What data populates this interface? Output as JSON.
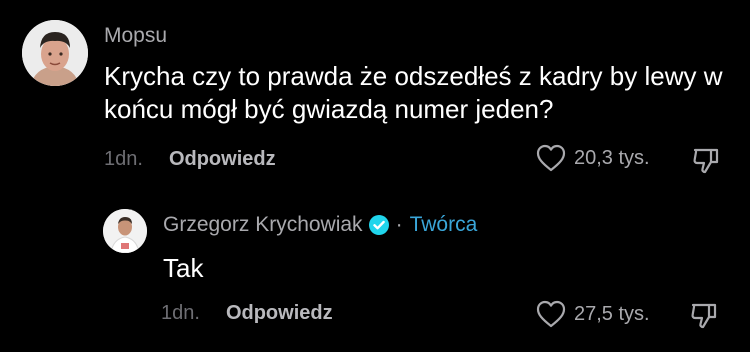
{
  "comments": [
    {
      "username": "Mopsu",
      "text": "Krycha czy to prawda że odszedłeś z kadry by lewy w końcu mógł być gwiazdą numer jeden?",
      "time": "1dn.",
      "reply_label": "Odpowiedz",
      "likes": "20,3 tys."
    },
    {
      "username": "Grzegorz Krychowiak",
      "badge_separator": "·",
      "badge_label": "Twórca",
      "text": "Tak",
      "time": "1dn.",
      "reply_label": "Odpowiedz",
      "likes": "27,5 tys."
    }
  ],
  "colors": {
    "background": "#000000",
    "secondary_text": "#a9a9ad",
    "creator_badge": "#3aa6d9",
    "verified": "#20d5ec"
  },
  "icons": [
    "heart-icon",
    "dislike-icon",
    "verified-icon"
  ]
}
